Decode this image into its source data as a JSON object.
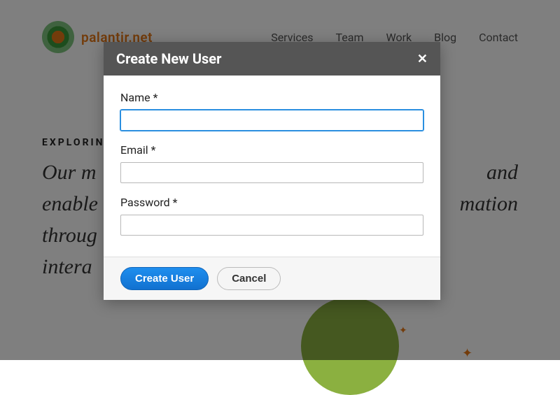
{
  "header": {
    "logo_text": "palantir.net",
    "nav": [
      "Services",
      "Team",
      "Work",
      "Blog",
      "Contact"
    ]
  },
  "hero": {
    "eyebrow": "EXPLORIN",
    "headline_line1": "Our m",
    "headline_line2": "enable",
    "headline_line3": "throug",
    "headline_line4": "intera",
    "headline_tail1": "and",
    "headline_tail2": "mation"
  },
  "modal": {
    "title": "Create New User",
    "close_glyph": "✕",
    "fields": {
      "name": {
        "label": "Name *",
        "value": ""
      },
      "email": {
        "label": "Email *",
        "value": ""
      },
      "password": {
        "label": "Password *",
        "value": ""
      }
    },
    "buttons": {
      "submit": "Create User",
      "cancel": "Cancel"
    }
  }
}
